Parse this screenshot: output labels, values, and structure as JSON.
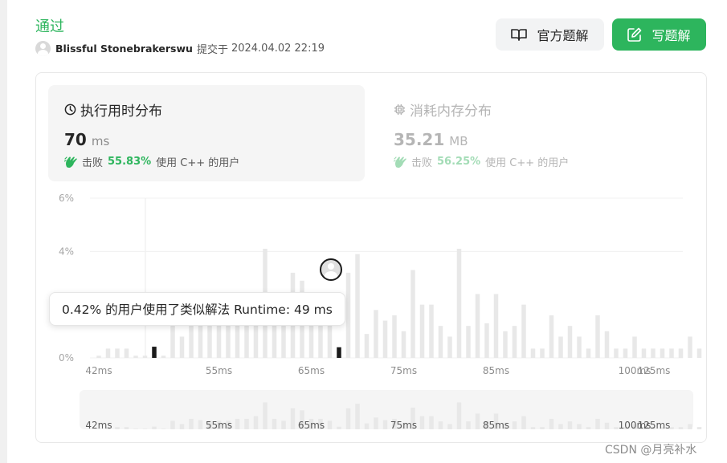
{
  "header": {
    "status": "通过",
    "username": "Blissful Stonebrakerswu",
    "submitted_label": "提交于",
    "submitted_time": "2024.04.02 22:19"
  },
  "buttons": {
    "official": "官方题解",
    "write": "写题解"
  },
  "runtime_tab": {
    "title": "执行用时分布",
    "value": "70",
    "unit": "ms",
    "beats_label": "击败",
    "beats_pct": "55.83%",
    "beats_suffix": "使用 C++ 的用户"
  },
  "memory_tab": {
    "title": "消耗内存分布",
    "value": "35.21",
    "unit": "MB",
    "beats_label": "击败",
    "beats_pct": "56.25%",
    "beats_suffix": "使用 C++ 的用户"
  },
  "tooltip": {
    "text": "0.42% 的用户使用了类似解法 Runtime: 49 ms"
  },
  "watermark": "CSDN @月亮补水",
  "colors": {
    "accent": "#2db55d",
    "bar": "#e8e8e8",
    "highlight": "#1a1a1a"
  },
  "chart_data": {
    "type": "bar",
    "x_start": 42,
    "x_step": 1,
    "x_unit": "ms",
    "ylim": [
      0,
      6
    ],
    "yticks": [
      "6%",
      "4%",
      "0%"
    ],
    "ytick_values": [
      6,
      4,
      0
    ],
    "xticks": [
      "42ms",
      "55ms",
      "65ms",
      "75ms",
      "85ms",
      "100ms",
      "125ms"
    ],
    "values": [
      0.08,
      0.35,
      0.35,
      0.35,
      0.08,
      0.08,
      0.42,
      0.08,
      1.3,
      0.8,
      1.6,
      1.4,
      1.3,
      1.3,
      1.3,
      1.6,
      1.6,
      2.0,
      4.1,
      1.6,
      1.3,
      3.2,
      2.9,
      1.6,
      1.6,
      1.3,
      0.4,
      3.2,
      3.9,
      0.9,
      1.8,
      1.4,
      1.6,
      1.0,
      3.3,
      2.0,
      2.0,
      1.2,
      0.8,
      4.1,
      1.2,
      2.4,
      1.3,
      2.4,
      1.0,
      1.2,
      2.0,
      0.35,
      0.35,
      1.6,
      0.8,
      1.2,
      0.8,
      0.35,
      1.6,
      1.0,
      0.35,
      0.35,
      0.8,
      0.35,
      0.35,
      0.35,
      0.35,
      0.35,
      0.8,
      0.35
    ],
    "highlight_indices": [
      6,
      26
    ]
  }
}
